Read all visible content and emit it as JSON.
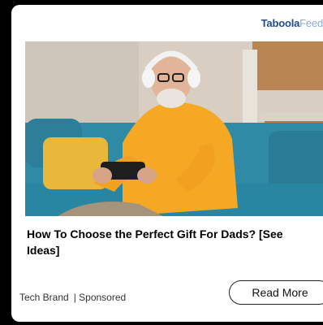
{
  "brand": {
    "name_part1": "Tab",
    "name_logo": "oo",
    "name_part2": "la",
    "feed": "Feed"
  },
  "ad": {
    "image_alt": "",
    "headline": "How To Choose the Perfect Gift For Dads? [See Ideas]",
    "source": "Tech Brand",
    "sponsored_label": "| Sponsored",
    "cta_label": "Read More"
  },
  "colors": {
    "brand_dark": "#1f4c8f",
    "brand_light": "#8fa9cf",
    "sweater": "#f4a823",
    "sofa": "#2f8aa6"
  }
}
